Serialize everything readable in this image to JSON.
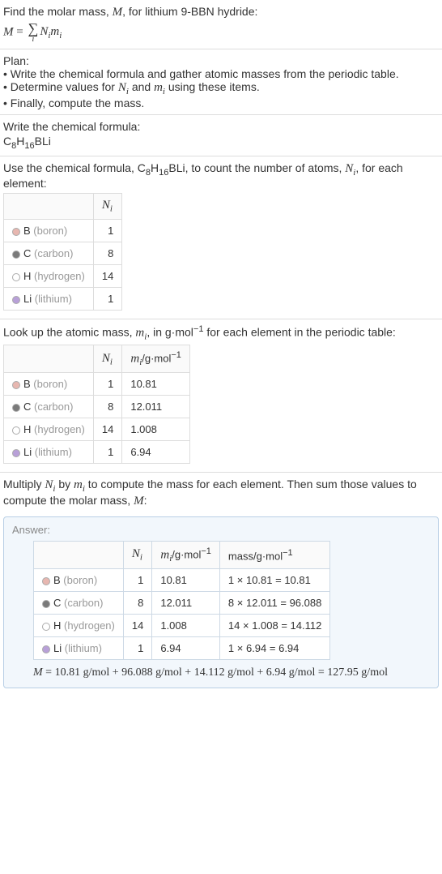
{
  "intro": {
    "line1_a": "Find the molar mass, ",
    "line1_M": "M",
    "line1_b": ", for lithium 9-BBN hydride:",
    "eq_M": "M",
    "eq_eq": " = ",
    "eq_sigma": "∑",
    "eq_i": "i",
    "eq_Nimi_N": "N",
    "eq_Nimi_i1": "i",
    "eq_Nimi_m": "m",
    "eq_Nimi_i2": "i"
  },
  "plan": {
    "heading": "Plan:",
    "b1": "• Write the chemical formula and gather atomic masses from the periodic table.",
    "b2_a": "• Determine values for ",
    "b2_N": "N",
    "b2_i1": "i",
    "b2_and": " and ",
    "b2_m": "m",
    "b2_i2": "i",
    "b2_b": " using these items.",
    "b3": "• Finally, compute the mass."
  },
  "cf": {
    "heading": "Write the chemical formula:",
    "c": "C",
    "c8": "8",
    "h": "H",
    "h16": "16",
    "bli": "BLi"
  },
  "count": {
    "text_a": "Use the chemical formula, ",
    "text_b": ", to count the number of atoms, ",
    "text_N": "N",
    "text_i": "i",
    "text_c": ", for each element:",
    "col_N": "N",
    "col_i": "i",
    "rows": [
      {
        "swatch": "#e7b7b0",
        "sym": "B",
        "name": " (boron)",
        "n": "1"
      },
      {
        "swatch": "#7a7a7a",
        "sym": "C",
        "name": " (carbon)",
        "n": "8"
      },
      {
        "swatch": "#ffffff",
        "sym": "H",
        "name": " (hydrogen)",
        "n": "14"
      },
      {
        "swatch": "#b8a0d8",
        "sym": "Li",
        "name": " (lithium)",
        "n": "1"
      }
    ]
  },
  "masses": {
    "text_a": "Look up the atomic mass, ",
    "text_m": "m",
    "text_i": "i",
    "text_b": ", in g·mol",
    "text_exp": "−1",
    "text_c": " for each element in the periodic table:",
    "col_N": "N",
    "col_Ni": "i",
    "col_m": "m",
    "col_mi": "i",
    "col_unit": "/g·mol",
    "col_exp": "−1",
    "rows": [
      {
        "swatch": "#e7b7b0",
        "sym": "B",
        "name": " (boron)",
        "n": "1",
        "m": "10.81"
      },
      {
        "swatch": "#7a7a7a",
        "sym": "C",
        "name": " (carbon)",
        "n": "8",
        "m": "12.011"
      },
      {
        "swatch": "#ffffff",
        "sym": "H",
        "name": " (hydrogen)",
        "n": "14",
        "m": "1.008"
      },
      {
        "swatch": "#b8a0d8",
        "sym": "Li",
        "name": " (lithium)",
        "n": "1",
        "m": "6.94"
      }
    ]
  },
  "multiply": {
    "text_a": "Multiply ",
    "N": "N",
    "i1": "i",
    "by": " by ",
    "m": "m",
    "i2": "i",
    "text_b": " to compute the mass for each element. Then sum those values to compute the molar mass, ",
    "M": "M",
    "colon": ":"
  },
  "answer": {
    "label": "Answer:",
    "col_N": "N",
    "col_Ni": "i",
    "col_m": "m",
    "col_mi": "i",
    "col_unit": "/g·mol",
    "col_exp": "−1",
    "col_mass": "mass/g·mol",
    "col_mass_exp": "−1",
    "rows": [
      {
        "swatch": "#e7b7b0",
        "sym": "B",
        "name": " (boron)",
        "n": "1",
        "m": "10.81",
        "calc": "1 × 10.81 = 10.81"
      },
      {
        "swatch": "#7a7a7a",
        "sym": "C",
        "name": " (carbon)",
        "n": "8",
        "m": "12.011",
        "calc": "8 × 12.011 = 96.088"
      },
      {
        "swatch": "#ffffff",
        "sym": "H",
        "name": " (hydrogen)",
        "n": "14",
        "m": "1.008",
        "calc": "14 × 1.008 = 14.112"
      },
      {
        "swatch": "#b8a0d8",
        "sym": "Li",
        "name": " (lithium)",
        "n": "1",
        "m": "6.94",
        "calc": "1 × 6.94 = 6.94"
      }
    ],
    "final_M": "M",
    "final_eq": " = 10.81 g/mol + 96.088 g/mol + 14.112 g/mol + 6.94 g/mol = 127.95 g/mol"
  }
}
